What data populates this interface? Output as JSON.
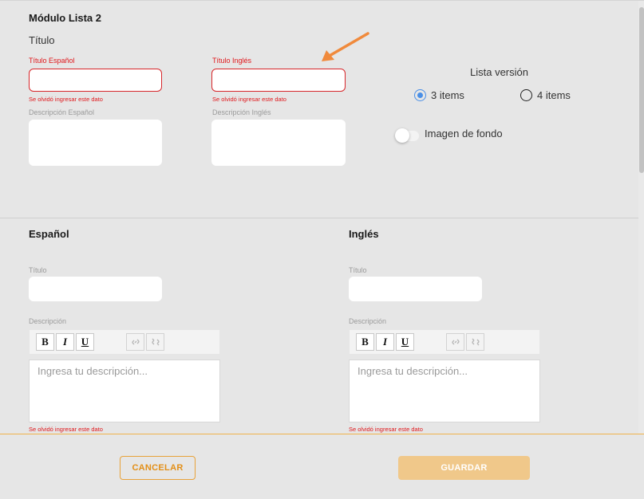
{
  "module": {
    "title": "Módulo Lista 2",
    "subtitle": "Título",
    "title_es_label": "Título Español",
    "title_en_label": "Título Inglés",
    "error_text": "Se olvidó ingresar este dato",
    "desc_es_label": "Descripción Español",
    "desc_en_label": "Descripción Inglés",
    "list_version_label": "Lista versión",
    "radio_3": "3 items",
    "radio_4": "4 items",
    "selected_version": "3 items",
    "background_toggle_label": "Imagen de fondo",
    "background_toggle_on": false
  },
  "spanish": {
    "heading": "Español",
    "title_label": "Título",
    "desc_label": "Descripción",
    "placeholder": "Ingresa tu descripción...",
    "error_text": "Se olvidó ingresar este dato"
  },
  "english": {
    "heading": "Inglés",
    "title_label": "Título",
    "desc_label": "Descripción",
    "placeholder": "Ingresa tu descripción...",
    "error_text": "Se olvidó ingresar este dato"
  },
  "toolbar": {
    "bold": "B",
    "italic": "I",
    "underline": "U",
    "link": "🔗",
    "unlink": "⛓"
  },
  "footer": {
    "cancel": "CANCELAR",
    "save": "GUARDAR"
  },
  "colors": {
    "accent": "#e38f17",
    "error": "#e0161a",
    "arrow": "#f08a3c",
    "radio_selected": "#4a8fe6"
  }
}
